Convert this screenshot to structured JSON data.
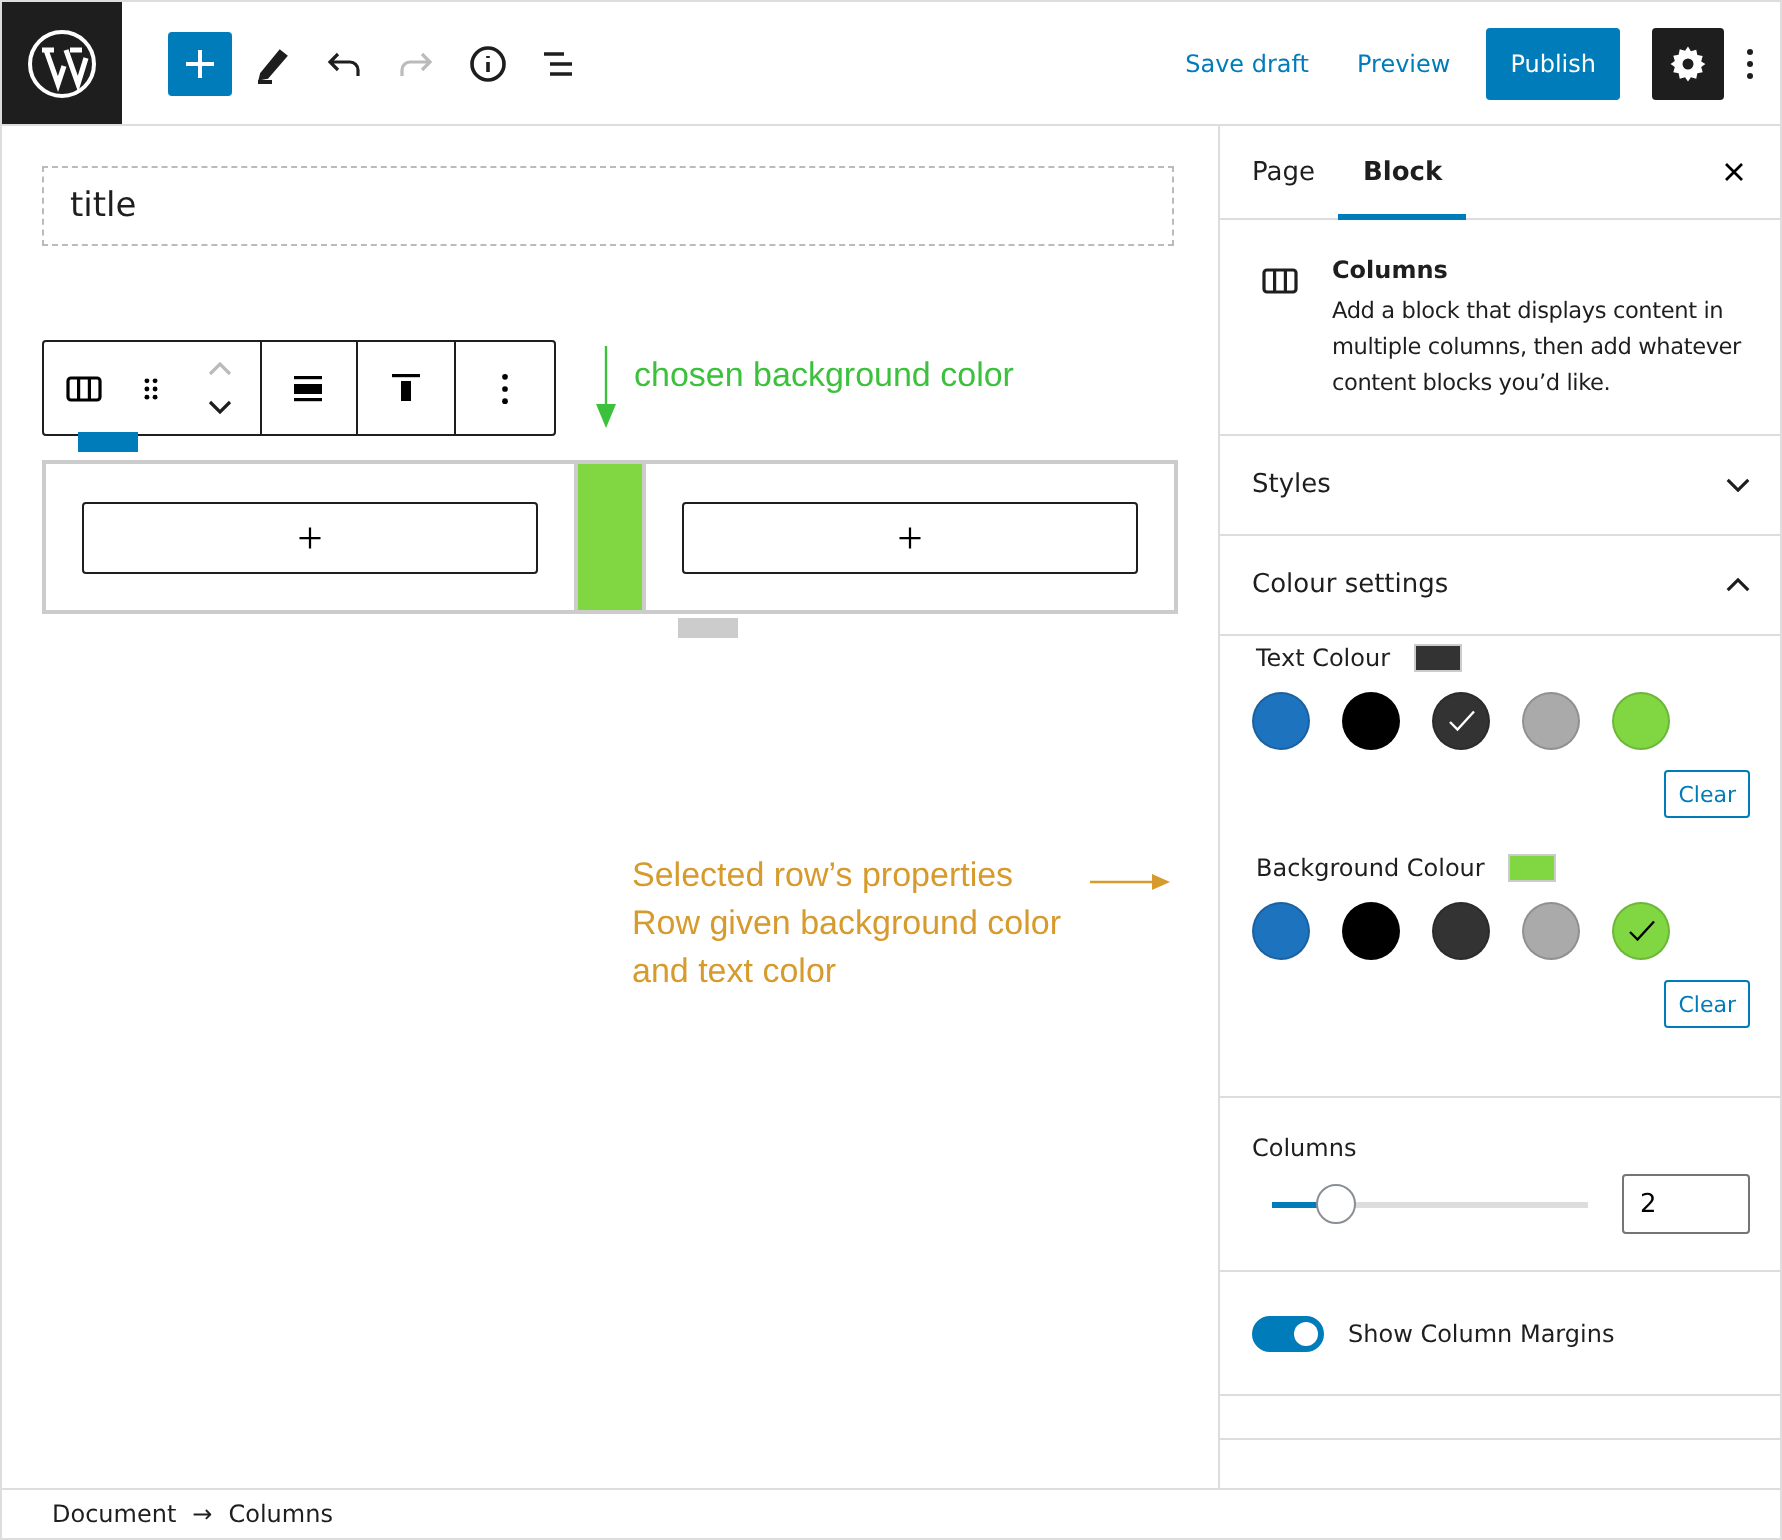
{
  "header": {
    "tools": [
      {
        "kind": "add",
        "disabled": false
      },
      {
        "kind": "edit",
        "disabled": false
      },
      {
        "kind": "undo",
        "disabled": false
      },
      {
        "kind": "redo",
        "disabled": true
      },
      {
        "kind": "info",
        "disabled": false
      },
      {
        "kind": "outline",
        "disabled": false
      }
    ],
    "actions": [
      "Save draft",
      "Preview"
    ],
    "publish": "Publish",
    "settings_active": true
  },
  "editor": {
    "title": {
      "placeholder": "title"
    },
    "block_toolbar": [
      {
        "kind": "columns"
      },
      {
        "kind": "align"
      },
      {
        "kind": "valign"
      },
      {
        "kind": "more"
      }
    ],
    "columns": [
      {
        "selected": true
      },
      {
        "selected": false
      }
    ],
    "annotations": [
      {
        "kind": "down",
        "text": "chosen background color",
        "color": "#3cc13c"
      },
      {
        "kind": "right",
        "text": "Selected row’s properties\nRow given background color\nand text color",
        "color": "#d69a2d"
      }
    ]
  },
  "sidebar": {
    "tabs": [
      {
        "label": "Page",
        "selected": false
      },
      {
        "label": "Block",
        "selected": true
      }
    ],
    "block": {
      "title": "Columns",
      "description": "Add a block that displays content in multiple columns, then add whatever content blocks you’d like."
    },
    "panels": [
      {
        "title": "Styles",
        "expanded": false
      },
      {
        "title": "Colour settings",
        "expanded": true
      }
    ],
    "palettes": [
      {
        "label": "Text Colour",
        "clear": "Clear",
        "swatches": [
          {
            "color": "#1e73be",
            "selected": false
          },
          {
            "color": "#000000",
            "selected": false
          },
          {
            "color": "#333333",
            "selected": true
          },
          {
            "color": "#aaaaaa",
            "selected": false
          },
          {
            "color": "#81d742",
            "selected": false
          }
        ]
      },
      {
        "label": "Background Colour",
        "clear": "Clear",
        "swatches": [
          {
            "color": "#1e73be",
            "selected": false
          },
          {
            "color": "#000000",
            "selected": false
          },
          {
            "color": "#333333",
            "selected": false
          },
          {
            "color": "#aaaaaa",
            "selected": false
          },
          {
            "color": "#81d742",
            "selected": true
          }
        ]
      }
    ],
    "columns_control": {
      "label": "Columns",
      "level": 0.2,
      "value": "2"
    },
    "toggle": {
      "label": "Show Column Margins",
      "on": true
    }
  },
  "breadcrumb": {
    "items": [
      "Document",
      "Columns"
    ],
    "separator": "→"
  }
}
